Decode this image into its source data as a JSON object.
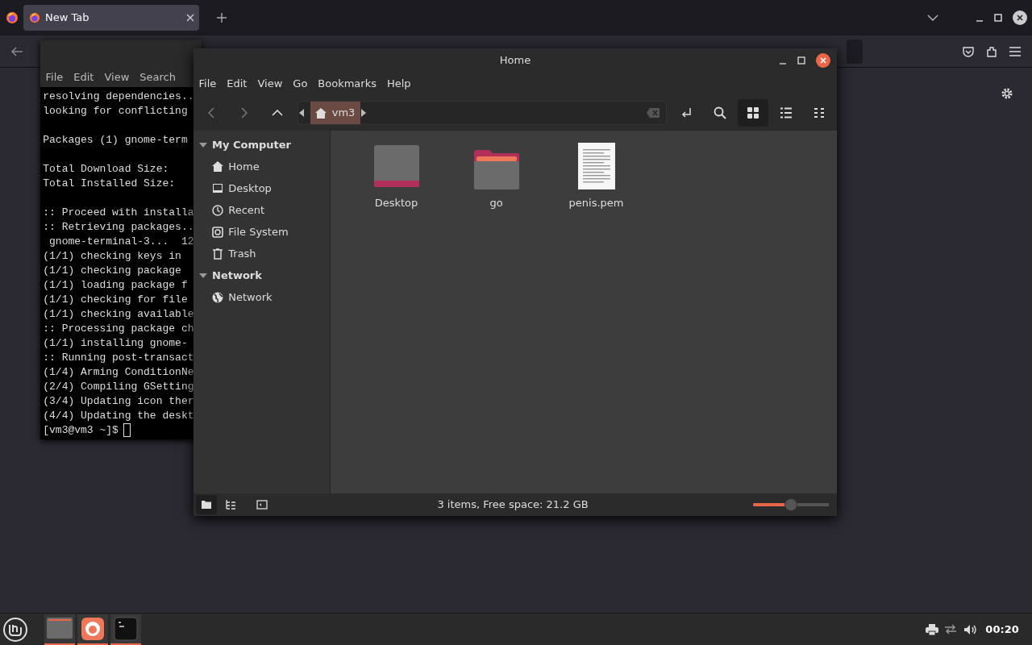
{
  "browser": {
    "tabs": [
      {
        "label": "New Tab",
        "selected": true
      }
    ]
  },
  "terminal": {
    "menu": [
      "File",
      "Edit",
      "View",
      "Search"
    ],
    "blocks": [
      [
        "resolving dependencies..",
        "looking for conflicting"
      ],
      [
        "Packages (1) gnome-term"
      ],
      [
        "Total Download Size:",
        "Total Installed Size:"
      ],
      [
        ":: Proceed with installa",
        ":: Retrieving packages..",
        " gnome-terminal-3...  12",
        "(1/1) checking keys in",
        "(1/1) checking package",
        "(1/1) loading package f",
        "(1/1) checking for file",
        "(1/1) checking available",
        ":: Processing package ch",
        "(1/1) installing gnome-",
        ":: Running post-transact",
        "(1/4) Arming ConditionNe",
        "(2/4) Compiling GSetting",
        "(3/4) Updating icon ther",
        "(4/4) Updating the deskt"
      ]
    ],
    "prompt": "[vm3@vm3 ~]$"
  },
  "file_manager": {
    "title": "Home",
    "menu": [
      "File",
      "Edit",
      "View",
      "Go",
      "Bookmarks",
      "Help"
    ],
    "breadcrumb": "vm3",
    "views": [
      {
        "kind": "grid",
        "selected": true
      },
      {
        "kind": "list",
        "selected": false
      },
      {
        "kind": "compact",
        "selected": false
      }
    ],
    "sidebar": [
      {
        "label": "My Computer",
        "expanded": true,
        "children": [
          {
            "label": "Home",
            "kind": "home"
          },
          {
            "label": "Desktop",
            "kind": "desktop"
          },
          {
            "label": "Recent",
            "kind": "recent"
          },
          {
            "label": "File System",
            "kind": "drive"
          },
          {
            "label": "Trash",
            "kind": "trash"
          }
        ]
      },
      {
        "label": "Network",
        "expanded": true,
        "children": [
          {
            "label": "Network",
            "kind": "network"
          }
        ]
      }
    ],
    "files": [
      {
        "name": "Desktop",
        "kind": "desktop"
      },
      {
        "name": "go",
        "kind": "folder"
      },
      {
        "name": "penis.pem",
        "kind": "document"
      }
    ],
    "pane_buttons": [
      {
        "kind": "places",
        "selected": true
      },
      {
        "kind": "tree",
        "selected": false
      },
      {
        "kind": "sidebar",
        "selected": false
      }
    ],
    "status": "3 items, Free space: 21.2 GB",
    "zoom": {
      "level": 0.5
    }
  },
  "taskbar": {
    "apps": [
      {
        "kind": "files",
        "active": true
      },
      {
        "kind": "browser",
        "active": true
      },
      {
        "kind": "terminal",
        "active": true
      }
    ],
    "clock": "00:20"
  }
}
